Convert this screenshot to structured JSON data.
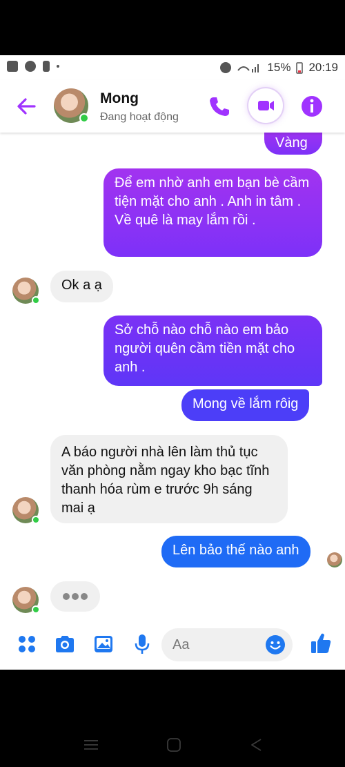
{
  "status_bar": {
    "battery": "15%",
    "time": "20:19"
  },
  "header": {
    "contact_name": "Mong",
    "contact_status": "Đang hoạt động"
  },
  "messages": [
    {
      "dir": "out",
      "text": "Vàng"
    },
    {
      "dir": "out",
      "text": "Để em nhờ anh em bạn bè cầm tiện mặt cho anh . Anh in tâm . Về quê là may lắm rồi ."
    },
    {
      "dir": "in",
      "text": "Ok a ạ"
    },
    {
      "dir": "out",
      "text": "Sở chỗ nào chỗ nào em bảo người quên cầm tiền mặt cho anh ."
    },
    {
      "dir": "out",
      "text": "Mong về lắm rôig"
    },
    {
      "dir": "in",
      "text": "A báo người nhà lên làm thủ tục văn phòng nằm ngay kho bạc tĩnh thanh hóa rùm e trước 9h sáng mai ạ"
    },
    {
      "dir": "out",
      "text": "Lên bảo thế nào anh"
    }
  ],
  "composer": {
    "placeholder": "Aa"
  },
  "colors": {
    "accent": "#a033ff",
    "bubble_blue": "#1f6bf5",
    "online": "#31cc46"
  },
  "icons": [
    "back-arrow-icon",
    "phone-icon",
    "video-call-icon",
    "info-icon",
    "menu-dots-icon",
    "camera-icon",
    "gallery-icon",
    "microphone-icon",
    "emoji-icon",
    "like-icon"
  ]
}
